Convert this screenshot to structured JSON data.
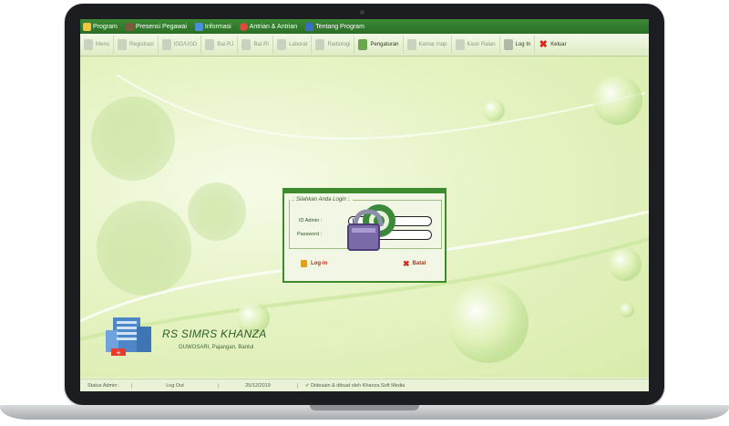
{
  "menubar": {
    "items": [
      {
        "label": "Program",
        "icon": "key-icon"
      },
      {
        "label": "Presensi Pegawai",
        "icon": "person-icon"
      },
      {
        "label": "Informasi",
        "icon": "info-chart-icon"
      },
      {
        "label": "Antrian & Antrian",
        "icon": "lifebuoy-icon"
      },
      {
        "label": "Tentang Program",
        "icon": "book-icon"
      }
    ]
  },
  "toolbar": {
    "items": [
      {
        "label": "Menu",
        "icon": "menu-icon",
        "active": false
      },
      {
        "label": "Registrasi",
        "icon": "register-icon",
        "active": false
      },
      {
        "label": "IGD/UGD",
        "icon": "emergency-icon",
        "active": false
      },
      {
        "label": "Bar.RJ",
        "icon": "outpatient-icon",
        "active": false
      },
      {
        "label": "Bar.RI",
        "icon": "inpatient-icon",
        "active": false
      },
      {
        "label": "Laborat",
        "icon": "lab-icon",
        "active": false
      },
      {
        "label": "Radiologi",
        "icon": "radiology-icon",
        "active": false
      },
      {
        "label": "Pengaturan",
        "icon": "settings-icon",
        "active": true
      },
      {
        "label": "Kamar Inap",
        "icon": "bed-icon",
        "active": false
      },
      {
        "label": "Kasir Ralan",
        "icon": "cashier-icon",
        "active": false
      },
      {
        "label": "Log In",
        "icon": "login-icon",
        "active": true
      },
      {
        "label": "Keluar",
        "icon": "close-icon",
        "active": true
      }
    ]
  },
  "login": {
    "legend": ".: Silahkan Anda Login :.",
    "id_label": "ID Admin :",
    "password_label": "Password :",
    "login_button": "Log-in",
    "cancel_button": "Batal"
  },
  "branding": {
    "name": "RS SIMRS KHANZA",
    "address": "GUWOSARI, Pajangan, Bantul"
  },
  "statusbar": {
    "status": "Status Admin :",
    "logout": "Log Out",
    "date": "25/12/2019",
    "credit": "Didesain & dibuat oleh Khanza.Soft Media"
  },
  "colors": {
    "menubar": "#2f7a2b",
    "accent": "#3e8a2f",
    "background": "#e6f3c4"
  }
}
